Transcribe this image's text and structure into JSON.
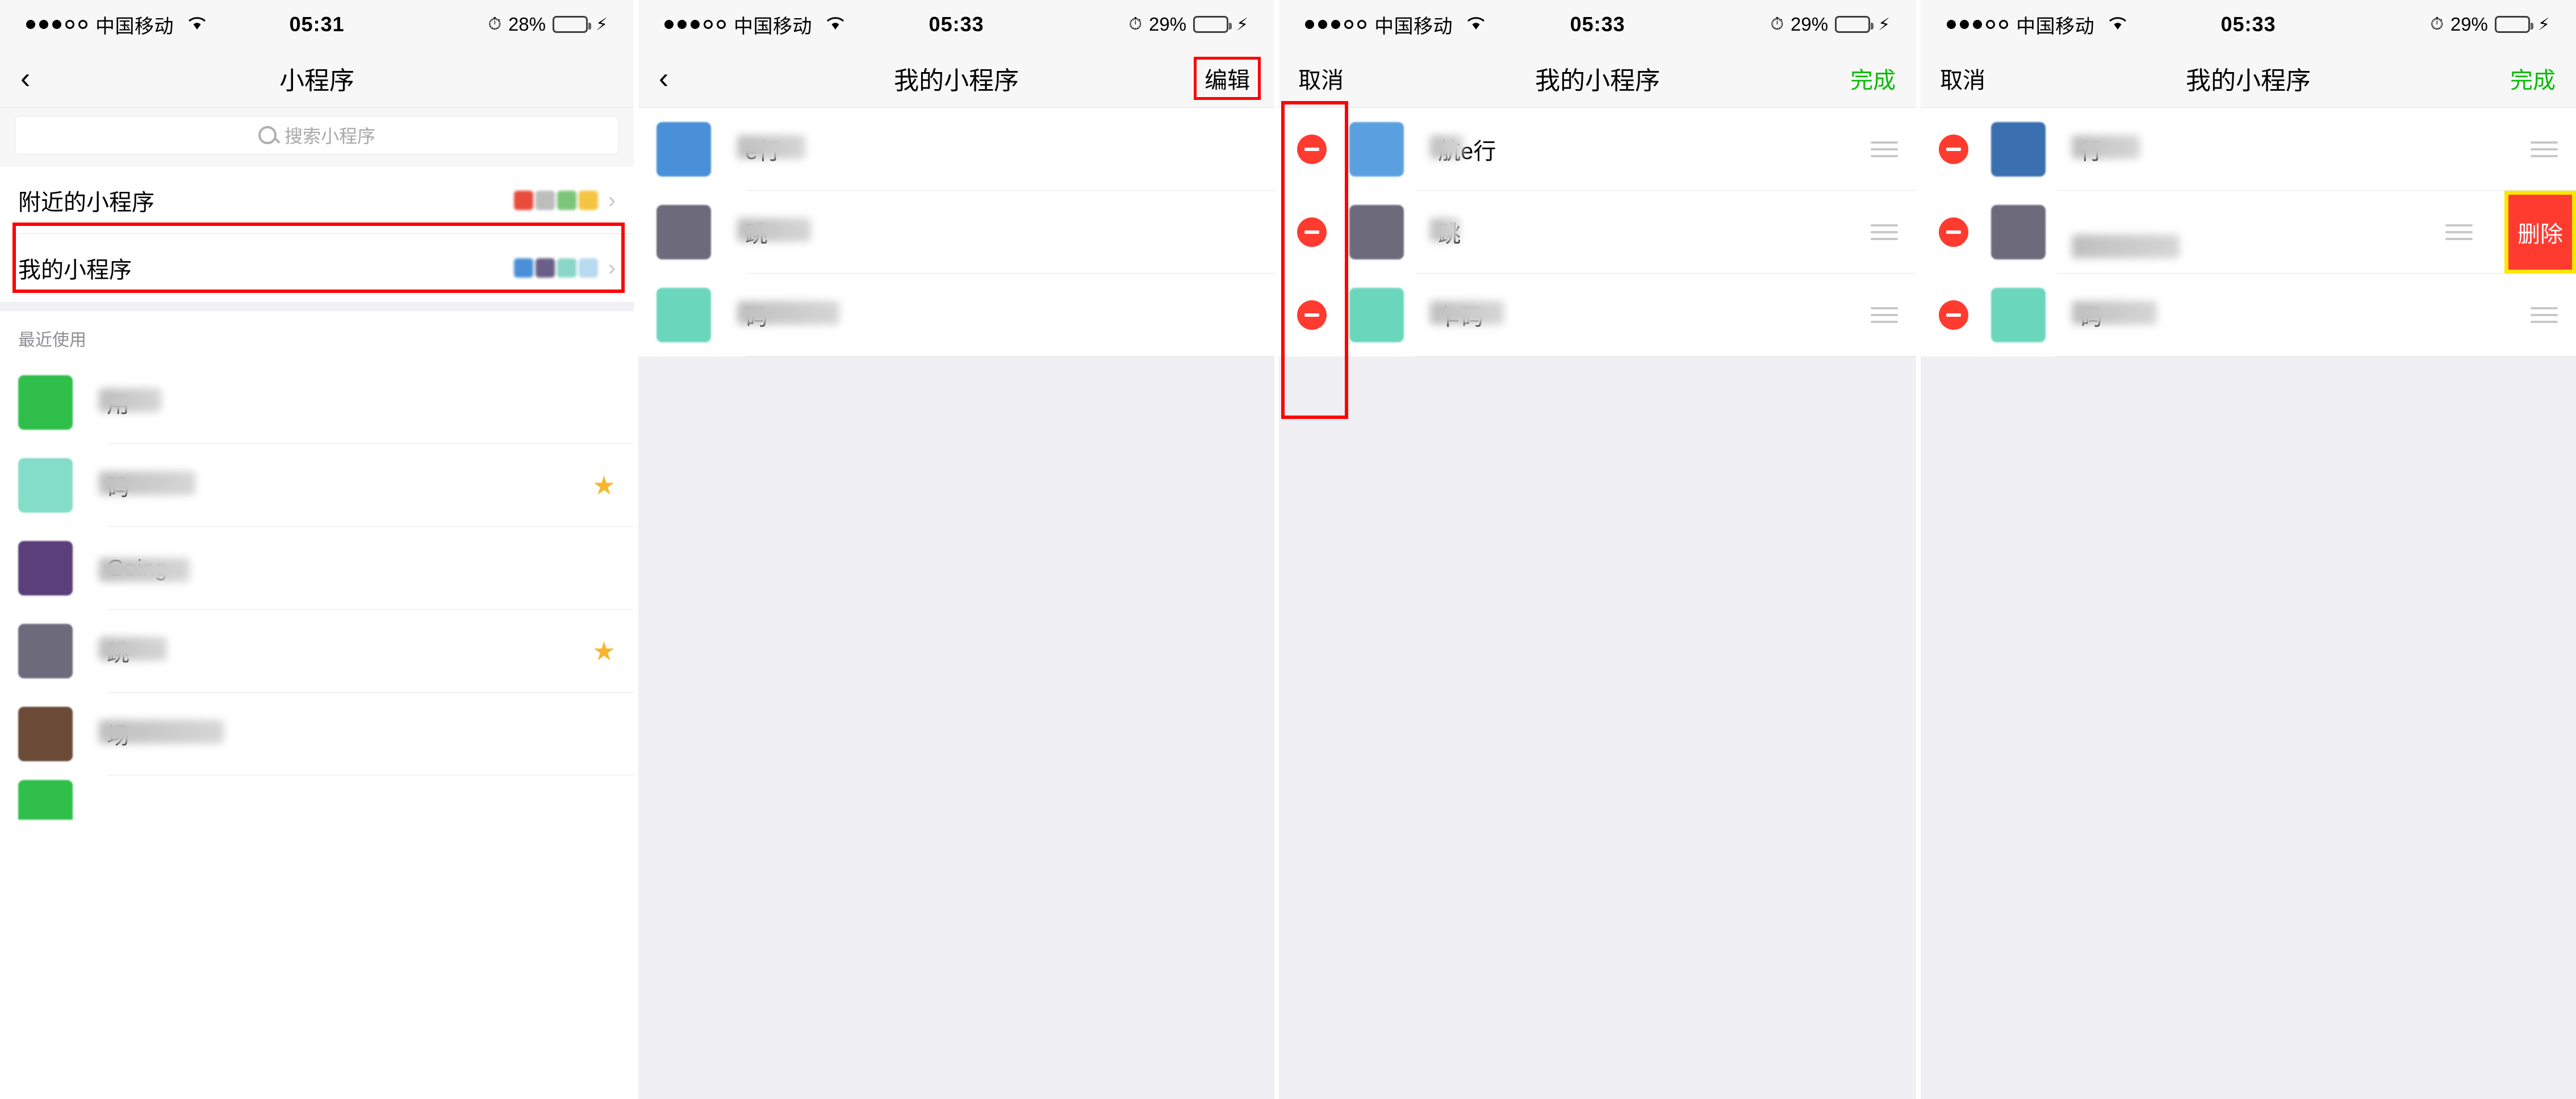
{
  "panels": [
    {
      "id": "panel-applist",
      "status": {
        "carrier": "中国移动",
        "time": "05:31",
        "battery_pct": "28%",
        "battery_level": 28,
        "signal_dots": [
          1,
          1,
          1,
          0,
          0
        ],
        "wifi_icon": "wifi-icon",
        "alarm_icon": "alarm-icon",
        "charging_icon": "lightning-icon"
      },
      "nav": {
        "back_icon": "back-chevron-icon",
        "title": "小程序",
        "right_label": ""
      },
      "search": {
        "placeholder": "搜索小程序",
        "icon": "search-icon"
      },
      "entries": [
        {
          "label": "附近的小程序",
          "chevron": "chevron-right-icon",
          "thumbs": [
            "#e84c3d",
            "#bdbdbd",
            "#7bc67b",
            "#f4c542"
          ]
        },
        {
          "label": "我的小程序",
          "chevron": "chevron-right-icon",
          "thumbs": [
            "#4a90d9",
            "#6a5f86",
            "#8ad6c8",
            "#b8d9ef"
          ],
          "highlighted": true
        }
      ],
      "recent_title": "最近使用",
      "recent_apps": [
        {
          "name": "用",
          "icon_color": "#2fbf4a",
          "starred": false
        },
        {
          "name": "码",
          "icon_color": "#84ddc9",
          "starred": true
        },
        {
          "name": "Going",
          "icon_color": "#5b3f7a",
          "starred": false
        },
        {
          "name": "跳",
          "icon_color": "#6d6a7c",
          "starred": true
        },
        {
          "name": "场",
          "icon_color": "#6b4a38",
          "starred": false
        },
        {
          "name": "",
          "icon_color": "#2fbf4a",
          "starred": false
        }
      ]
    },
    {
      "id": "panel-myapps-view",
      "status": {
        "carrier": "中国移动",
        "time": "05:33",
        "battery_pct": "29%",
        "battery_level": 29,
        "signal_dots": [
          1,
          1,
          1,
          0,
          0
        ],
        "wifi_icon": "wifi-icon",
        "alarm_icon": "alarm-icon",
        "charging_icon": "lightning-icon"
      },
      "nav": {
        "back_icon": "back-chevron-icon",
        "title": "我的小程序",
        "right_label": "编辑",
        "right_highlighted": true
      },
      "apps": [
        {
          "name": "e行",
          "icon_color": "#4a90d9"
        },
        {
          "name": "跳",
          "icon_color": "#6d6a7c"
        },
        {
          "name": "码",
          "icon_color": "#6ad7bd"
        }
      ]
    },
    {
      "id": "panel-myapps-edit",
      "status": {
        "carrier": "中国移动",
        "time": "05:33",
        "battery_pct": "29%",
        "battery_level": 29,
        "signal_dots": [
          1,
          1,
          1,
          0,
          0
        ],
        "wifi_icon": "wifi-icon",
        "alarm_icon": "alarm-icon",
        "charging_icon": "lightning-icon"
      },
      "nav": {
        "left_label": "取消",
        "title": "我的小程序",
        "right_label": "完成"
      },
      "delete_icon": "minus-circle-icon",
      "drag_icon": "drag-handle-icon",
      "apps": [
        {
          "name": "航e行",
          "icon_color": "#5aa0e0"
        },
        {
          "name": "跳",
          "icon_color": "#6d6a7c"
        },
        {
          "name": "乍码",
          "icon_color": "#6ad7bd"
        }
      ]
    },
    {
      "id": "panel-myapps-delete",
      "status": {
        "carrier": "中国移动",
        "time": "05:33",
        "battery_pct": "29%",
        "battery_level": 29,
        "signal_dots": [
          1,
          1,
          1,
          0,
          0
        ],
        "wifi_icon": "wifi-icon",
        "alarm_icon": "alarm-icon",
        "charging_icon": "lightning-icon"
      },
      "nav": {
        "left_label": "取消",
        "title": "我的小程序",
        "right_label": "完成"
      },
      "delete_icon": "minus-circle-icon",
      "drag_icon": "drag-handle-icon",
      "delete_button_label": "删除",
      "apps": [
        {
          "name": "行",
          "icon_color": "#3a6fb0"
        },
        {
          "name": "",
          "icon_color": "#6d6a7c",
          "swiped": true
        },
        {
          "name": "码",
          "icon_color": "#6ad7bd"
        }
      ]
    }
  ],
  "colors": {
    "accent_green": "#09bb07",
    "annotation_red": "#ff0000",
    "delete_red": "#ff3b30",
    "highlight_yellow": "#ffe600",
    "star_yellow": "#f8b62d",
    "page_bg": "#efeff4"
  }
}
